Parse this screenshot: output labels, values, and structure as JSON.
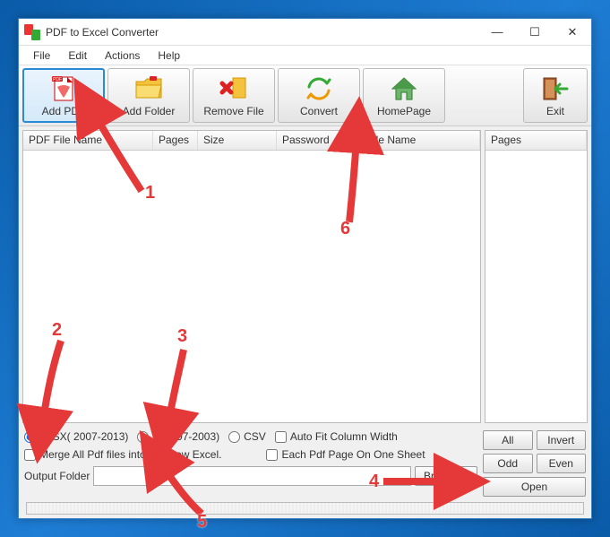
{
  "window": {
    "title": "PDF to Excel Converter"
  },
  "menu": {
    "file": "File",
    "edit": "Edit",
    "actions": "Actions",
    "help": "Help"
  },
  "toolbar": {
    "add_pdf": "Add PDF",
    "add_folder": "Add Folder",
    "remove_file": "Remove File",
    "convert": "Convert",
    "homepage": "HomePage",
    "exit": "Exit"
  },
  "columns": {
    "main": {
      "name": "PDF File Name",
      "pages": "Pages",
      "size": "Size",
      "password": "Password",
      "fullname": "Full File Name"
    },
    "side": {
      "pages": "Pages"
    }
  },
  "options": {
    "xlsx": "XLSX( 2007-2013)",
    "xls": "XLS(97-2003)",
    "csv": "CSV",
    "autofit": "Auto Fit Column Width",
    "merge": "Merge All Pdf files into one new Excel.",
    "each_page": "Each Pdf Page On One Sheet",
    "output_label": "Output Folder",
    "output_value": ""
  },
  "buttons": {
    "all": "All",
    "invert": "Invert",
    "odd": "Odd",
    "even": "Even",
    "browse": "Browse...",
    "open": "Open"
  },
  "annotations": {
    "n1": "1",
    "n2": "2",
    "n3": "3",
    "n4": "4",
    "n5": "5",
    "n6": "6"
  }
}
